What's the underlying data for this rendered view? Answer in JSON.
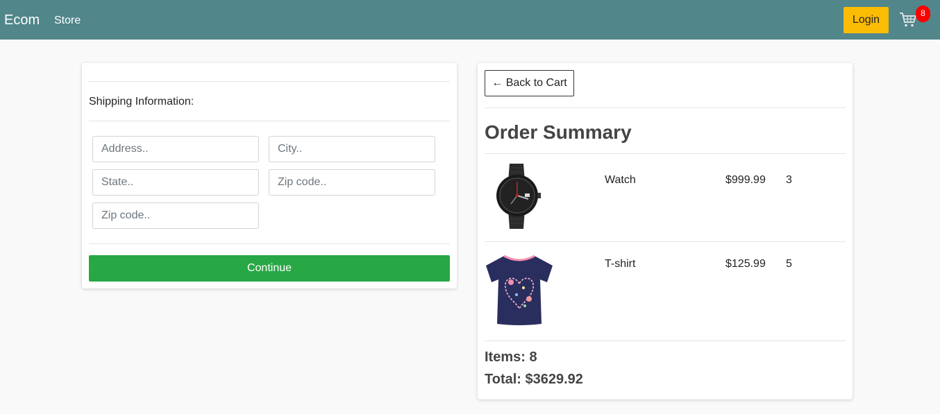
{
  "navbar": {
    "brand": "Ecom",
    "links": [
      "Store"
    ],
    "login_label": "Login",
    "cart_count": "8",
    "cart_icon": "shopping-cart-icon"
  },
  "shipping": {
    "heading": "Shipping Information:",
    "fields": [
      {
        "placeholder": "Address.."
      },
      {
        "placeholder": "City.."
      },
      {
        "placeholder": "State.."
      },
      {
        "placeholder": "Zip code.."
      },
      {
        "placeholder": "Zip code.."
      }
    ],
    "continue_label": "Continue"
  },
  "summary": {
    "back_label": "← Back to Cart",
    "title": "Order Summary",
    "items": [
      {
        "name": "Watch",
        "price": "$999.99",
        "quantity": "3",
        "image": "watch-image"
      },
      {
        "name": "T-shirt",
        "price": "$125.99",
        "quantity": "5",
        "image": "tshirt-image"
      }
    ],
    "items_label": "Items: 8",
    "total_label": "Total: $3629.92"
  },
  "colors": {
    "navbar": "#51868b",
    "login": "#fbbc04",
    "continue": "#28a745",
    "badge": "#ff0000"
  }
}
